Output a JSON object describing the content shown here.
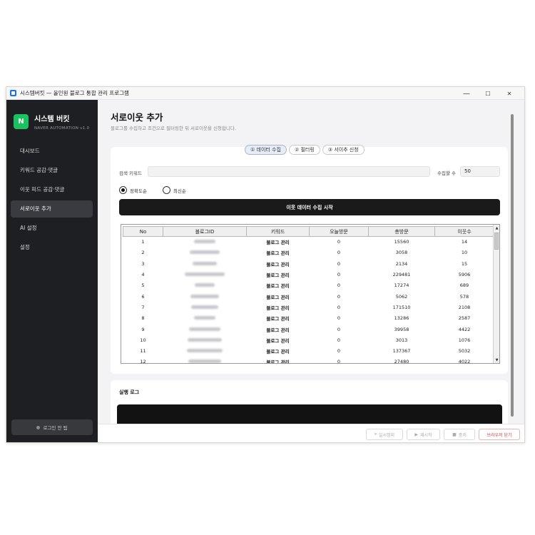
{
  "window": {
    "title": "시스템버킷 — 올인원 블로그 통합 관리 프로그램",
    "minimize": "—",
    "maximize": "☐",
    "close": "✕"
  },
  "sidebar": {
    "logo_letter": "N",
    "brand_name": "시스템 버킷",
    "brand_sub": "NAVER AUTOMATION v1.0",
    "items": [
      {
        "label": "대시보드"
      },
      {
        "label": "키워드 공감·댓글"
      },
      {
        "label": "이웃 피드 공감·댓글"
      },
      {
        "label": "서로이웃 추가"
      },
      {
        "label": "AI 설정"
      },
      {
        "label": "설정"
      }
    ],
    "active_index": 3,
    "login_status": "로그인 안 됨"
  },
  "page": {
    "title": "서로이웃 추가",
    "description": "블로그를 수집하고 조건으로 필터링한 뒤 서로이웃을 신청합니다."
  },
  "tabs": [
    {
      "label": "① 데이터 수집",
      "active": true
    },
    {
      "label": "② 필터링",
      "active": false
    },
    {
      "label": "③ 서이추 신청",
      "active": false
    }
  ],
  "form": {
    "keyword_label": "검색 키워드",
    "keyword_value": "",
    "count_label": "수집할 수",
    "count_value": "50",
    "sort_options": [
      {
        "label": "정확도순",
        "checked": true
      },
      {
        "label": "최신순",
        "checked": false
      }
    ],
    "start_button": "이웃 데이터 수집 시작"
  },
  "table": {
    "columns": [
      "No",
      "블로그ID",
      "키워드",
      "오늘방문",
      "총방문",
      "이웃수"
    ],
    "rows": [
      {
        "no": "1",
        "blog_id_w": 30,
        "keyword": "블로그 관리",
        "today": "0",
        "total": "15560",
        "neighbors": "14"
      },
      {
        "no": "2",
        "blog_id_w": 42,
        "keyword": "블로그 관리",
        "today": "0",
        "total": "3058",
        "neighbors": "10"
      },
      {
        "no": "3",
        "blog_id_w": 34,
        "keyword": "블로그 관리",
        "today": "0",
        "total": "2134",
        "neighbors": "15"
      },
      {
        "no": "4",
        "blog_id_w": 56,
        "keyword": "블로그 관리",
        "today": "0",
        "total": "229481",
        "neighbors": "5906"
      },
      {
        "no": "5",
        "blog_id_w": 28,
        "keyword": "블로그 관리",
        "today": "0",
        "total": "17274",
        "neighbors": "689"
      },
      {
        "no": "6",
        "blog_id_w": 40,
        "keyword": "블로그 관리",
        "today": "0",
        "total": "5062",
        "neighbors": "578"
      },
      {
        "no": "7",
        "blog_id_w": 38,
        "keyword": "블로그 관리",
        "today": "0",
        "total": "171510",
        "neighbors": "2108"
      },
      {
        "no": "8",
        "blog_id_w": 30,
        "keyword": "블로그 관리",
        "today": "0",
        "total": "13286",
        "neighbors": "2587"
      },
      {
        "no": "9",
        "blog_id_w": 44,
        "keyword": "블로그 관리",
        "today": "0",
        "total": "39958",
        "neighbors": "4422"
      },
      {
        "no": "10",
        "blog_id_w": 48,
        "keyword": "블로그 관리",
        "today": "0",
        "total": "3013",
        "neighbors": "1076"
      },
      {
        "no": "11",
        "blog_id_w": 50,
        "keyword": "블로그 관리",
        "today": "0",
        "total": "137367",
        "neighbors": "5032"
      },
      {
        "no": "12",
        "blog_id_w": 46,
        "keyword": "블로그 관리",
        "today": "0",
        "total": "27480",
        "neighbors": "4022"
      }
    ]
  },
  "log": {
    "title": "실행 로그"
  },
  "footer": {
    "pause": "일시정지",
    "resume": "재시작",
    "stop": "중지",
    "close_browser": "브라우저 닫기"
  },
  "colors": {
    "sidebar_bg": "#1e1f22",
    "brand_green": "#19c15f",
    "primary_btn": "#1a1a1a",
    "danger": "#d93a3a"
  }
}
